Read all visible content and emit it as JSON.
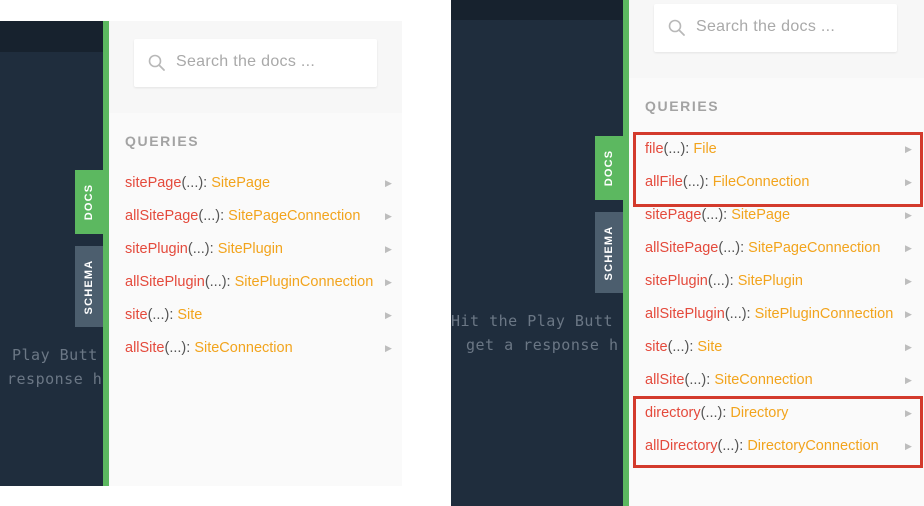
{
  "left": {
    "hint_lines": [
      "Play Butt",
      "response h"
    ],
    "search": {
      "placeholder": "Search the docs ..."
    },
    "section_title": "QUERIES",
    "tabs": {
      "docs": "DOCS",
      "schema": "SCHEMA"
    },
    "queries": [
      {
        "name": "sitePage",
        "args": "(...): ",
        "type": "SitePage"
      },
      {
        "name": "allSitePage",
        "args": "(...): ",
        "type": "SitePageConnection"
      },
      {
        "name": "sitePlugin",
        "args": "(...): ",
        "type": "SitePlugin"
      },
      {
        "name": "allSitePlugin",
        "args": "(...): ",
        "type": "SitePluginConnection"
      },
      {
        "name": "site",
        "args": "(...): ",
        "type": "Site"
      },
      {
        "name": "allSite",
        "args": "(...): ",
        "type": "SiteConnection"
      }
    ]
  },
  "right": {
    "hint_lines": [
      "Hit the Play Butt",
      "get a response h"
    ],
    "search": {
      "placeholder": "Search the docs ..."
    },
    "section_title": "QUERIES",
    "tabs": {
      "docs": "DOCS",
      "schema": "SCHEMA"
    },
    "queries": [
      {
        "name": "file",
        "args": "(...): ",
        "type": "File"
      },
      {
        "name": "allFile",
        "args": "(...): ",
        "type": "FileConnection"
      },
      {
        "name": "sitePage",
        "args": "(...): ",
        "type": "SitePage"
      },
      {
        "name": "allSitePage",
        "args": "(...): ",
        "type": "SitePageConnection"
      },
      {
        "name": "sitePlugin",
        "args": "(...): ",
        "type": "SitePlugin"
      },
      {
        "name": "allSitePlugin",
        "args": "(...): ",
        "type": "SitePluginConnection"
      },
      {
        "name": "site",
        "args": "(...): ",
        "type": "Site"
      },
      {
        "name": "allSite",
        "args": "(...): ",
        "type": "SiteConnection"
      },
      {
        "name": "directory",
        "args": "(...): ",
        "type": "Directory"
      },
      {
        "name": "allDirectory",
        "args": "(...): ",
        "type": "DirectoryConnection"
      }
    ]
  },
  "icons": {
    "search": "search-icon",
    "chevron": "chevron-right-icon"
  },
  "colors": {
    "editor_bg": "#1f2d3d",
    "accent_green": "#5cb860",
    "query_name": "#e44a3c",
    "query_type": "#f2a41d",
    "highlight": "#d33a2c"
  }
}
